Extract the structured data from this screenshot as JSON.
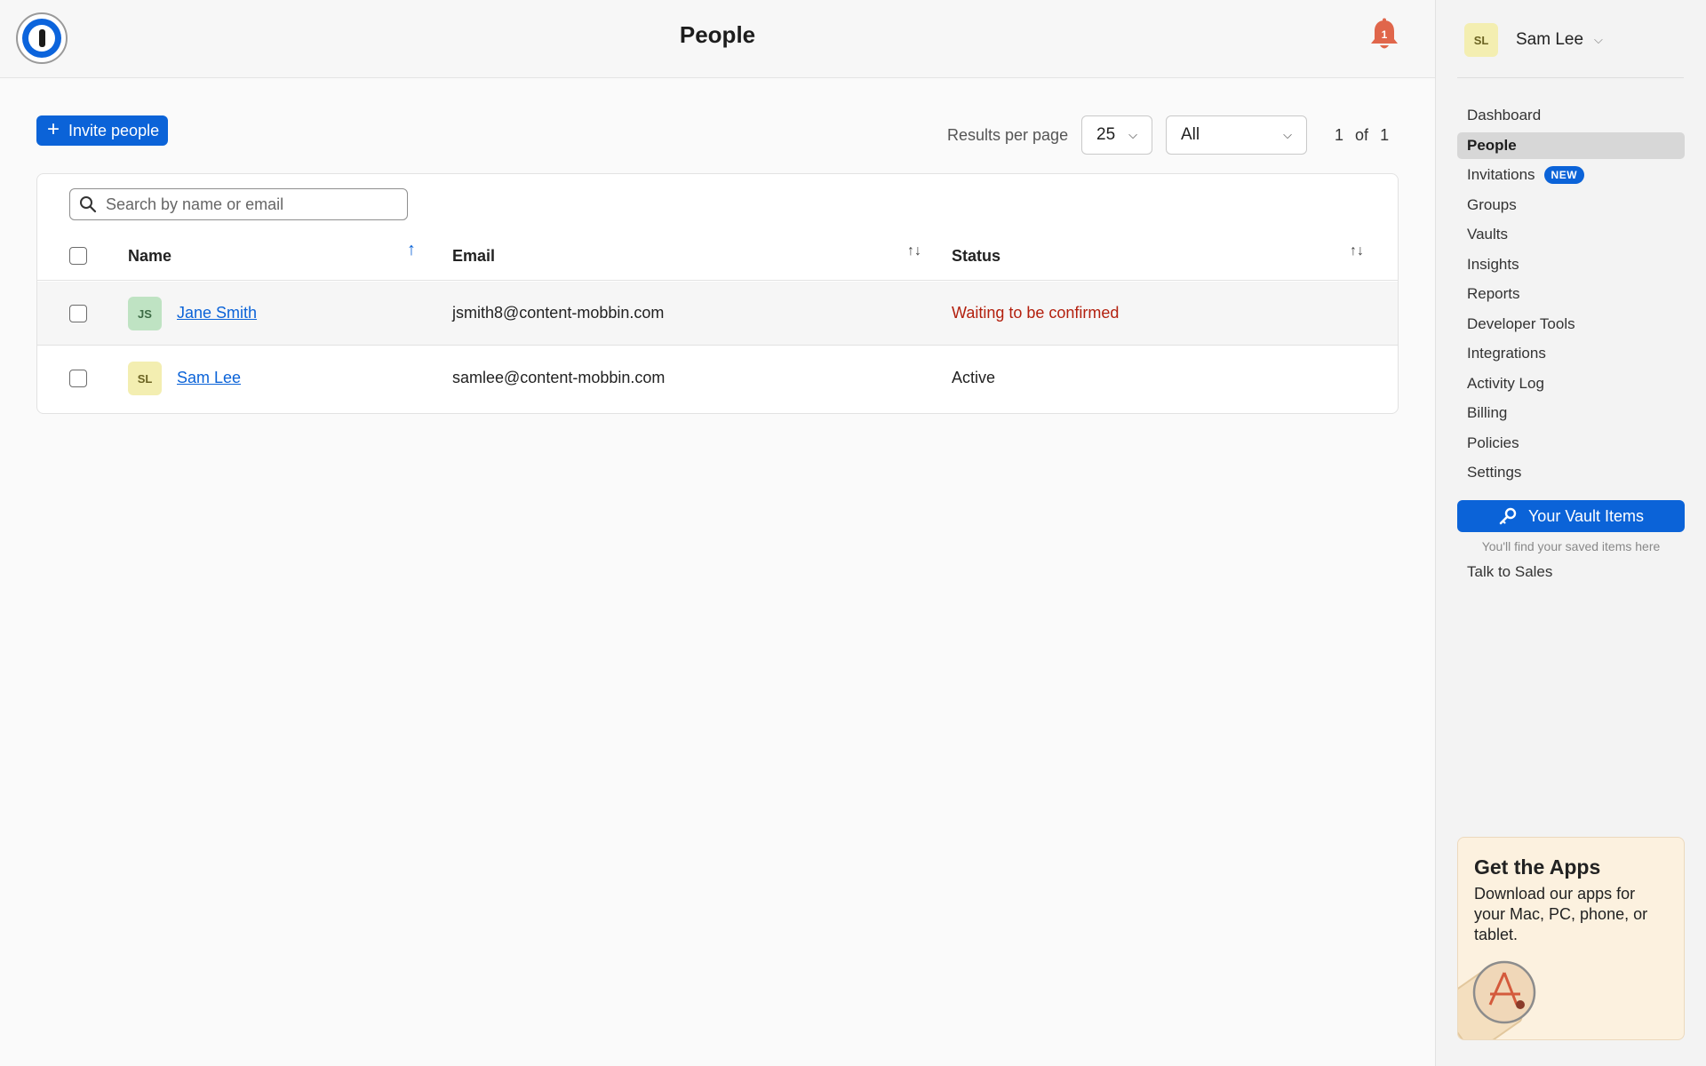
{
  "header": {
    "title": "People",
    "notification_count": "1"
  },
  "toolbar": {
    "invite_label": "Invite people",
    "results_per_page_label": "Results per page",
    "per_page_value": "25",
    "filter_value": "All",
    "page_current": "1",
    "page_of": "of",
    "page_total": "1"
  },
  "search": {
    "placeholder": "Search by name or email"
  },
  "table": {
    "columns": [
      "Name",
      "Email",
      "Status"
    ],
    "rows": [
      {
        "initials": "JS",
        "name": "Jane Smith",
        "email": "jsmith8@content-mobbin.com",
        "status": "Waiting to be confirmed"
      },
      {
        "initials": "SL",
        "name": "Sam Lee",
        "email": "samlee@content-mobbin.com",
        "status": "Active"
      }
    ]
  },
  "sidebar": {
    "user_initials": "SL",
    "user_name": "Sam Lee",
    "items": [
      {
        "label": "Dashboard"
      },
      {
        "label": "People"
      },
      {
        "label": "Invitations",
        "badge": "NEW"
      },
      {
        "label": "Groups"
      },
      {
        "label": "Vaults"
      },
      {
        "label": "Insights"
      },
      {
        "label": "Reports"
      },
      {
        "label": "Developer Tools"
      },
      {
        "label": "Integrations"
      },
      {
        "label": "Activity Log"
      },
      {
        "label": "Billing"
      },
      {
        "label": "Policies"
      },
      {
        "label": "Settings"
      }
    ],
    "vault_button_label": "Your Vault Items",
    "vault_hint": "You'll find your saved items here",
    "talk_to_sales": "Talk to Sales",
    "apps_title": "Get the Apps",
    "apps_text": "Download our apps for your Mac, PC, phone, or tablet."
  },
  "colors": {
    "accent": "#0b63d8",
    "warning_status": "#b3200e",
    "bell": "#e0664b"
  }
}
